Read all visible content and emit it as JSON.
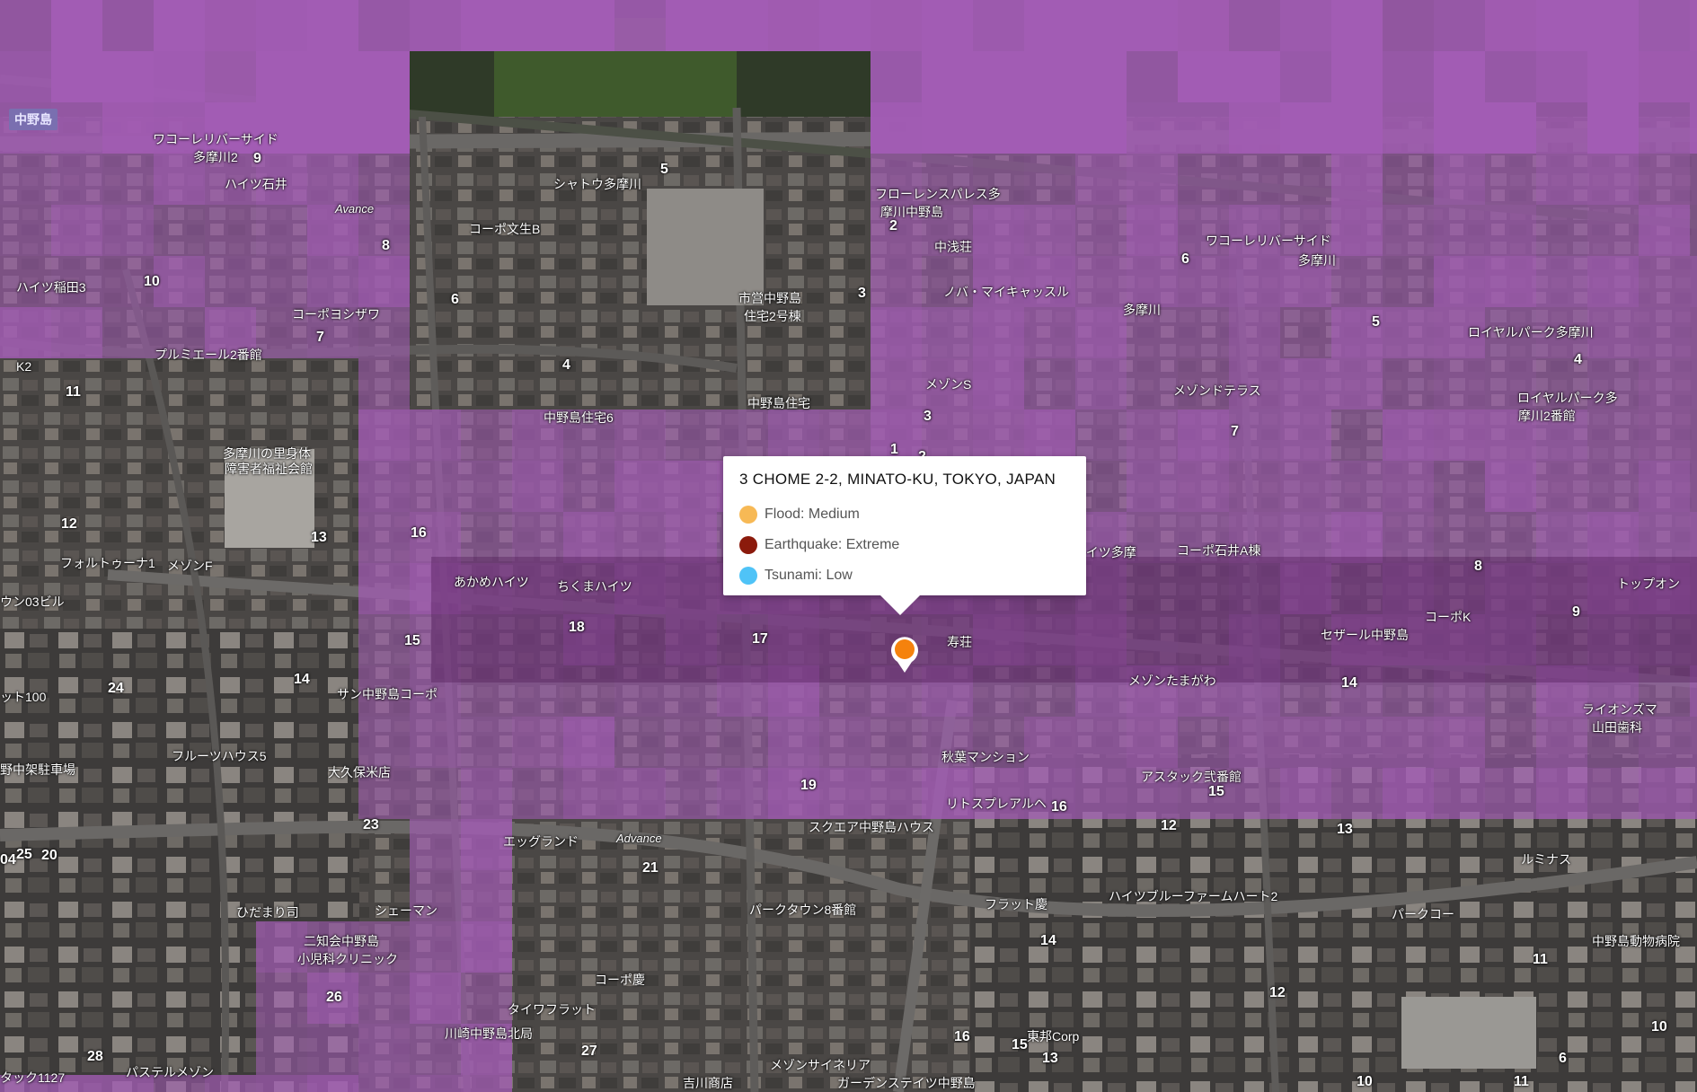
{
  "popup": {
    "title": "3 CHOME 2-2, MINATO-KU, TOKYO, JAPAN",
    "risks": [
      {
        "label": "Flood: Medium",
        "color": "#f7b955"
      },
      {
        "label": "Earthquake: Extreme",
        "color": "#8b1a0c"
      },
      {
        "label": "Tsunami: Low",
        "color": "#4fc3f7"
      }
    ]
  },
  "marker": {
    "icon": "location-pin-icon",
    "color": "#f5820d"
  },
  "overlay": {
    "color": "#a25cb4"
  },
  "area_chip": "中野島",
  "map_labels": [
    {
      "text": "ワコーレリバーサイド",
      "type": "place"
    },
    {
      "text": "多摩川2",
      "type": "place"
    },
    {
      "text": "ハイツ石井",
      "type": "place"
    },
    {
      "text": "Avance",
      "type": "road"
    },
    {
      "text": "シャトウ多摩川",
      "type": "place"
    },
    {
      "text": "コーポ文生B",
      "type": "place"
    },
    {
      "text": "市営中野島",
      "type": "place"
    },
    {
      "text": "住宅2号棟",
      "type": "place"
    },
    {
      "text": "フローレンスパレス多",
      "type": "place"
    },
    {
      "text": "摩川中野島",
      "type": "place"
    },
    {
      "text": "中浅荘",
      "type": "place"
    },
    {
      "text": "ワコーレリバーサイド",
      "type": "place"
    },
    {
      "text": "多摩川",
      "type": "place"
    },
    {
      "text": "ハイツ稲田3",
      "type": "place"
    },
    {
      "text": "コーポヨシザワ",
      "type": "place"
    },
    {
      "text": "ノバ・マイキャッスル",
      "type": "place"
    },
    {
      "text": "多摩川",
      "type": "place"
    },
    {
      "text": "ロイヤルパーク多摩川",
      "type": "place"
    },
    {
      "text": "プルミエール2番館",
      "type": "place"
    },
    {
      "text": "中野島住宅6",
      "type": "place"
    },
    {
      "text": "中野島住宅",
      "type": "place"
    },
    {
      "text": "メゾンS",
      "type": "place"
    },
    {
      "text": "メゾンドテラス",
      "type": "place"
    },
    {
      "text": "ロイヤルパーク多",
      "type": "place"
    },
    {
      "text": "摩川2番館",
      "type": "place"
    },
    {
      "text": "多摩川の里身体",
      "type": "place"
    },
    {
      "text": "障害者福祉会館",
      "type": "place"
    },
    {
      "text": "ハイツ多摩",
      "type": "place"
    },
    {
      "text": "コーポ石井A棟",
      "type": "place"
    },
    {
      "text": "フォルトゥーナ1",
      "type": "place"
    },
    {
      "text": "メゾンF",
      "type": "place"
    },
    {
      "text": "あかめハイツ",
      "type": "place"
    },
    {
      "text": "ちくまハイツ",
      "type": "place"
    },
    {
      "text": "トップオン",
      "type": "place"
    },
    {
      "text": "ウン03ビル",
      "type": "place"
    },
    {
      "text": "コーポK",
      "type": "place"
    },
    {
      "text": "セザール中野島",
      "type": "place"
    },
    {
      "text": "寿荘",
      "type": "place"
    },
    {
      "text": "ット100",
      "type": "place"
    },
    {
      "text": "サン中野島コーポ",
      "type": "place"
    },
    {
      "text": "メゾンたまがわ",
      "type": "place"
    },
    {
      "text": "ライオンズマ",
      "type": "place"
    },
    {
      "text": "山田歯科",
      "type": "place"
    },
    {
      "text": "フルーツハウス5",
      "type": "place"
    },
    {
      "text": "秋葉マンション",
      "type": "place"
    },
    {
      "text": "野中架駐車場",
      "type": "place"
    },
    {
      "text": "大久保米店",
      "type": "place"
    },
    {
      "text": "アスタック弐番館",
      "type": "place"
    },
    {
      "text": "リトスプレアルヘ",
      "type": "place"
    },
    {
      "text": "スクエア中野島ハウス",
      "type": "place"
    },
    {
      "text": "エッグランド",
      "type": "place"
    },
    {
      "text": "Advance",
      "type": "road"
    },
    {
      "text": "ルミナス",
      "type": "place"
    },
    {
      "text": "フラット慶",
      "type": "place"
    },
    {
      "text": "ハイツブルーファームハート2",
      "type": "place"
    },
    {
      "text": "パークコー",
      "type": "place"
    },
    {
      "text": "ひだまり司",
      "type": "place"
    },
    {
      "text": "シェーマン",
      "type": "place"
    },
    {
      "text": "パークタウン8番館",
      "type": "place"
    },
    {
      "text": "中野島動物病院",
      "type": "place"
    },
    {
      "text": "二知会中野島",
      "type": "place"
    },
    {
      "text": "小児科クリニック",
      "type": "place"
    },
    {
      "text": "コーポ慶",
      "type": "place"
    },
    {
      "text": "タイワフラット",
      "type": "place"
    },
    {
      "text": "川崎中野島北局",
      "type": "place"
    },
    {
      "text": "東邦Corp",
      "type": "place"
    },
    {
      "text": "メゾンサイネリア",
      "type": "place"
    },
    {
      "text": "ガーデンステイツ中野島",
      "type": "place"
    },
    {
      "text": "パステルメゾン",
      "type": "place"
    },
    {
      "text": "タック1127",
      "type": "place"
    },
    {
      "text": "吉川商店",
      "type": "place"
    },
    {
      "text": "K2",
      "type": "place"
    }
  ],
  "block_numbers": [
    "9",
    "8",
    "5",
    "6",
    "4",
    "3",
    "2",
    "1",
    "10",
    "11",
    "7",
    "6",
    "5",
    "4",
    "12",
    "13",
    "16",
    "3",
    "2",
    "7",
    "8",
    "9",
    "24",
    "14",
    "15",
    "18",
    "17",
    "14",
    "19",
    "16",
    "15",
    "23",
    "25",
    "20",
    "21",
    "13",
    "12",
    "11",
    "14",
    "10",
    "6",
    "26",
    "27",
    "28",
    "16",
    "15",
    "13",
    "12",
    "04",
    "10",
    "11"
  ]
}
